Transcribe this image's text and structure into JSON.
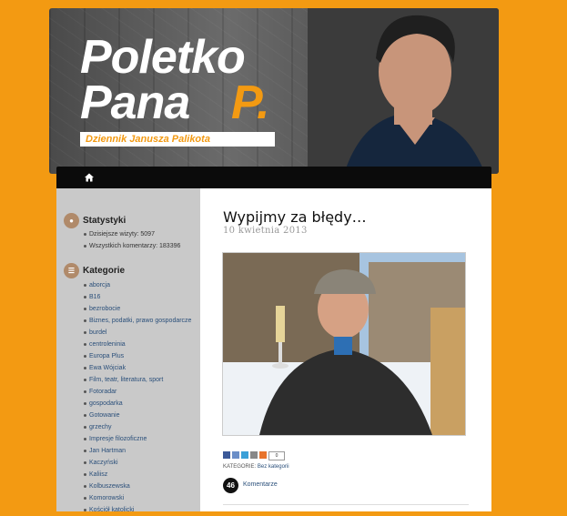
{
  "header": {
    "logo_line1": "Poletko",
    "logo_line2": "Pana",
    "logo_p": "P.",
    "tagline": "Dziennik Janusza Palikota"
  },
  "nav": {
    "home_icon": "home-icon"
  },
  "sidebar": {
    "stats": {
      "title": "Statystyki",
      "icon": "stats-icon",
      "items": [
        "Dzisiejsze wizyty: 5097",
        "Wszystkich komentarzy: 183396"
      ]
    },
    "categories": {
      "title": "Kategorie",
      "icon": "list-icon",
      "items": [
        "aborcja",
        "B16",
        "bezrobocie",
        "Biznes, podatki, prawo gospodarcze",
        "burdel",
        "centroleninia",
        "Europa Plus",
        "Ewa Wójciak",
        "Film, teatr, literatura, sport",
        "Fotoradar",
        "gospodarka",
        "Gotowanie",
        "grzechy",
        "Impresje filozoficzne",
        "Jan Hartman",
        "Kaczyński",
        "Kaliisz",
        "Kolbuszewska",
        "Komorowski",
        "Kościół katolicki"
      ]
    }
  },
  "post": {
    "title": "Wypijmy za błędy…",
    "date": "10 kwietnia 2013",
    "share_count": "0",
    "categories_label": "KATEGORIE:",
    "categories_value": "Bez kategorii",
    "comments_count": "46",
    "comments_label": "Komentarze"
  },
  "colors": {
    "background": "#f39a12",
    "accent": "#f39a12",
    "link": "#2a4f7a"
  }
}
